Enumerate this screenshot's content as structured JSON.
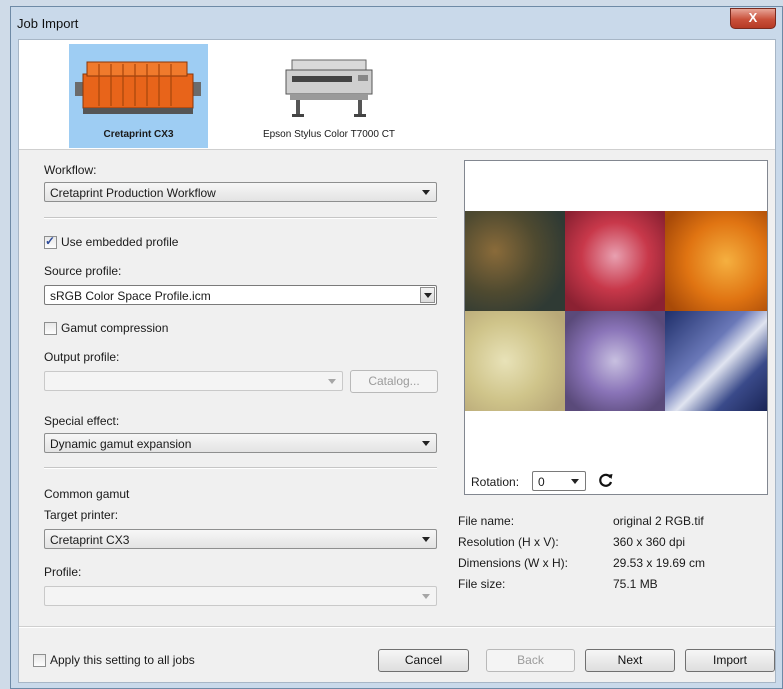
{
  "window": {
    "title": "Job Import",
    "close_label": "X"
  },
  "printers": [
    {
      "name": "Cretaprint CX3",
      "selected": true
    },
    {
      "name": "Epson Stylus Color T7000 CT",
      "selected": false
    }
  ],
  "form": {
    "workflow_label": "Workflow:",
    "workflow_value": "Cretaprint Production Workflow",
    "use_embedded_label": "Use embedded profile",
    "use_embedded_checked": true,
    "source_profile_label": "Source profile:",
    "source_profile_value": "sRGB Color Space Profile.icm",
    "gamut_compression_label": "Gamut compression",
    "gamut_compression_checked": false,
    "output_profile_label": "Output profile:",
    "output_profile_value": "",
    "catalog_label": "Catalog...",
    "special_effect_label": "Special effect:",
    "special_effect_value": "Dynamic gamut expansion",
    "common_gamut_label": "Common gamut",
    "target_printer_label": "Target printer:",
    "target_printer_value": "Cretaprint CX3",
    "profile_label": "Profile:",
    "profile_value": ""
  },
  "preview": {
    "rotation_label": "Rotation:",
    "rotation_value": "0",
    "rotate_icon": "rotate-clockwise-icon",
    "file_name_label": "File name:",
    "file_name_value": "original 2 RGB.tif",
    "resolution_label": "Resolution (H x V):",
    "resolution_value": "360 x 360 dpi",
    "dimensions_label": "Dimensions (W x H):",
    "dimensions_value": "29.53 x 19.69 cm",
    "file_size_label": "File size:",
    "file_size_value": "75.1 MB"
  },
  "footer": {
    "apply_all_label": "Apply this setting to all jobs",
    "apply_all_checked": false,
    "cancel_label": "Cancel",
    "back_label": "Back",
    "next_label": "Next",
    "import_label": "Import"
  }
}
